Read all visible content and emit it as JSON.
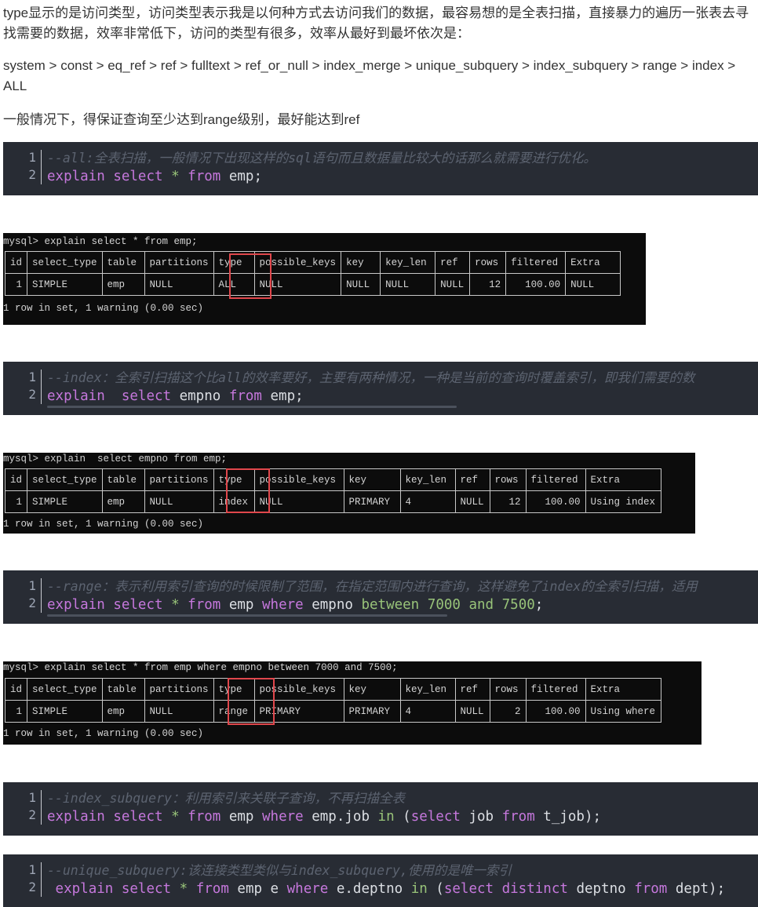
{
  "paragraphs": {
    "intro": "type显示的是访问类型，访问类型表示我是以何种方式去访问我们的数据，最容易想的是全表扫描，直接暴力的遍历一张表去寻找需要的数据，效率非常低下，访问的类型有很多，效率从最好到最坏依次是：",
    "order": "system > const > eq_ref > ref > fulltext > ref_or_null > index_merge > unique_subquery > index_subquery > range > index > ALL",
    "advice": "一般情况下，得保证查询至少达到range级别，最好能达到ref"
  },
  "code_blocks": [
    {
      "line_numbers": [
        "1",
        "2"
      ],
      "comment": "--all:全表扫描，一般情况下出现这样的sql语句而且数据量比较大的话那么就需要进行优化。",
      "tokens": [
        {
          "t": "explain",
          "c": "kw"
        },
        {
          "t": " "
        },
        {
          "t": "select",
          "c": "kw"
        },
        {
          "t": " "
        },
        {
          "t": "*",
          "c": "op"
        },
        {
          "t": " "
        },
        {
          "t": "from",
          "c": "kw"
        },
        {
          "t": " emp;",
          "c": "id"
        }
      ]
    },
    {
      "line_numbers": [
        "1",
        "2"
      ],
      "comment": "--index：全索引扫描这个比all的效率要好，主要有两种情况，一种是当前的查询时覆盖索引，即我们需要的数",
      "tokens": [
        {
          "t": "explain",
          "c": "kw"
        },
        {
          "t": "  "
        },
        {
          "t": "select",
          "c": "kw"
        },
        {
          "t": " empno ",
          "c": "id"
        },
        {
          "t": "from",
          "c": "kw"
        },
        {
          "t": " emp;",
          "c": "id"
        }
      ]
    },
    {
      "line_numbers": [
        "1",
        "2"
      ],
      "comment": "--range：表示利用索引查询的时候限制了范围，在指定范围内进行查询，这样避免了index的全索引扫描，适用",
      "tokens": [
        {
          "t": "explain",
          "c": "kw"
        },
        {
          "t": " "
        },
        {
          "t": "select",
          "c": "kw"
        },
        {
          "t": " "
        },
        {
          "t": "*",
          "c": "op"
        },
        {
          "t": " "
        },
        {
          "t": "from",
          "c": "kw"
        },
        {
          "t": " emp ",
          "c": "id"
        },
        {
          "t": "where",
          "c": "kw"
        },
        {
          "t": " empno ",
          "c": "id"
        },
        {
          "t": "between",
          "c": "op"
        },
        {
          "t": " "
        },
        {
          "t": "7000",
          "c": "num"
        },
        {
          "t": " "
        },
        {
          "t": "and",
          "c": "op"
        },
        {
          "t": " "
        },
        {
          "t": "7500",
          "c": "num"
        },
        {
          "t": ";",
          "c": "id"
        }
      ]
    },
    {
      "line_numbers": [
        "1",
        "2"
      ],
      "comment": "--index_subquery：利用索引来关联子查询，不再扫描全表",
      "tokens": [
        {
          "t": "explain",
          "c": "kw"
        },
        {
          "t": " "
        },
        {
          "t": "select",
          "c": "kw"
        },
        {
          "t": " "
        },
        {
          "t": "*",
          "c": "op"
        },
        {
          "t": " "
        },
        {
          "t": "from",
          "c": "kw"
        },
        {
          "t": " emp ",
          "c": "id"
        },
        {
          "t": "where",
          "c": "kw"
        },
        {
          "t": " emp.job ",
          "c": "id"
        },
        {
          "t": "in",
          "c": "op"
        },
        {
          "t": " (",
          "c": "id"
        },
        {
          "t": "select",
          "c": "kw"
        },
        {
          "t": " job ",
          "c": "id"
        },
        {
          "t": "from",
          "c": "kw"
        },
        {
          "t": " t_job);",
          "c": "id"
        }
      ]
    },
    {
      "line_numbers": [
        "1",
        "2"
      ],
      "comment": "--unique_subquery:该连接类型类似与index_subquery,使用的是唯一索引",
      "tokens": [
        {
          "t": " "
        },
        {
          "t": "explain",
          "c": "kw"
        },
        {
          "t": " "
        },
        {
          "t": "select",
          "c": "kw"
        },
        {
          "t": " "
        },
        {
          "t": "*",
          "c": "op"
        },
        {
          "t": " "
        },
        {
          "t": "from",
          "c": "kw"
        },
        {
          "t": " emp e ",
          "c": "id"
        },
        {
          "t": "where",
          "c": "kw"
        },
        {
          "t": " e.deptno ",
          "c": "id"
        },
        {
          "t": "in",
          "c": "op"
        },
        {
          "t": " (",
          "c": "id"
        },
        {
          "t": "select",
          "c": "kw"
        },
        {
          "t": " "
        },
        {
          "t": "distinct",
          "c": "kw"
        },
        {
          "t": " deptno ",
          "c": "id"
        },
        {
          "t": "from",
          "c": "kw"
        },
        {
          "t": " dept);",
          "c": "id"
        }
      ]
    }
  ],
  "terminals": [
    {
      "command": "mysql> explain select * from emp;",
      "headers": [
        "id",
        "select_type",
        "table",
        "partitions",
        "type",
        "possible_keys",
        "key",
        "key_len",
        "ref",
        "rows",
        "filtered",
        "Extra"
      ],
      "row": [
        "1",
        "SIMPLE",
        "emp",
        "NULL",
        "ALL",
        "NULL",
        "NULL",
        "NULL",
        "NULL",
        "12",
        "100.00",
        "NULL"
      ],
      "footer": "1 row in set, 1 warning (0.00 sec)",
      "highlight_column": "type"
    },
    {
      "command": "mysql> explain  select empno from emp;",
      "headers": [
        "id",
        "select_type",
        "table",
        "partitions",
        "type",
        "possible_keys",
        "key",
        "key_len",
        "ref",
        "rows",
        "filtered",
        "Extra"
      ],
      "row": [
        "1",
        "SIMPLE",
        "emp",
        "NULL",
        "index",
        "NULL",
        "PRIMARY",
        "4",
        "NULL",
        "12",
        "100.00",
        "Using index"
      ],
      "footer": "1 row in set, 1 warning (0.00 sec)",
      "highlight_column": "type"
    },
    {
      "command": "mysql> explain select * from emp where empno between 7000 and 7500;",
      "headers": [
        "id",
        "select_type",
        "table",
        "partitions",
        "type",
        "possible_keys",
        "key",
        "key_len",
        "ref",
        "rows",
        "filtered",
        "Extra"
      ],
      "row": [
        "1",
        "SIMPLE",
        "emp",
        "NULL",
        "range",
        "PRIMARY",
        "PRIMARY",
        "4",
        "NULL",
        "2",
        "100.00",
        "Using where"
      ],
      "footer": "1 row in set, 1 warning (0.00 sec)",
      "highlight_column": "type"
    }
  ],
  "colors": {
    "code_bg": "#282c34",
    "keyword": "#c678dd",
    "operator": "#98c379",
    "comment": "#5c6370",
    "terminal_bg": "#0c0c0c",
    "highlight_box": "#e0474c"
  }
}
